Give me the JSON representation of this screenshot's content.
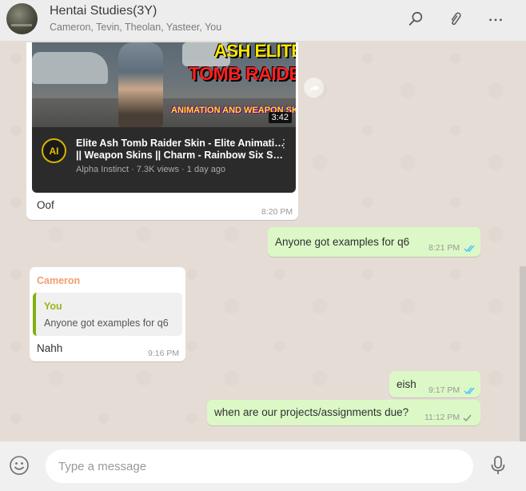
{
  "header": {
    "title": "Hentai Studies(3Y)",
    "participants": "Cameron, Tevin, Theolan, Yasteer, You",
    "icons": [
      "search-icon",
      "paperclip-icon",
      "more-options-icon"
    ]
  },
  "messages": {
    "video_card": {
      "thumbnail_text_1": "ASH ELITE",
      "thumbnail_text_2": "TOMB RAIDER",
      "thumbnail_text_3": "ANIMATION AND WEAPON SKINS",
      "duration": "3:42",
      "channel_initials": "AI",
      "title_line1": "Elite Ash Tomb Raider Skin - Elite Animation",
      "title_line2": "|| Weapon Skins || Charm - Rainbow Six Sie…",
      "meta": "Alpha Instinct · 7.3K views · 1 day ago"
    },
    "msg1": {
      "text": "Oof",
      "time": "8:20 PM"
    },
    "msg2": {
      "text": "Anyone got examples for q6",
      "time": "8:21 PM",
      "status": "read"
    },
    "msg3": {
      "sender": "Cameron",
      "quote_author": "You",
      "quote_text": "Anyone got examples for q6",
      "text": "Nahh",
      "time": "9:16 PM"
    },
    "msg4": {
      "text": "eish",
      "time": "9:17 PM",
      "status": "read"
    },
    "msg5": {
      "text": "when are our projects/assignments due?",
      "time": "11:12 PM",
      "status": "sent"
    }
  },
  "composer": {
    "placeholder": "Type a message",
    "value": ""
  },
  "colors": {
    "chat_background": "#e5ddd5",
    "incoming_bubble": "#ffffff",
    "outgoing_bubble": "#dcf8c6",
    "read_tick": "#4fc3f7",
    "sender_name": "#f29d6f"
  }
}
